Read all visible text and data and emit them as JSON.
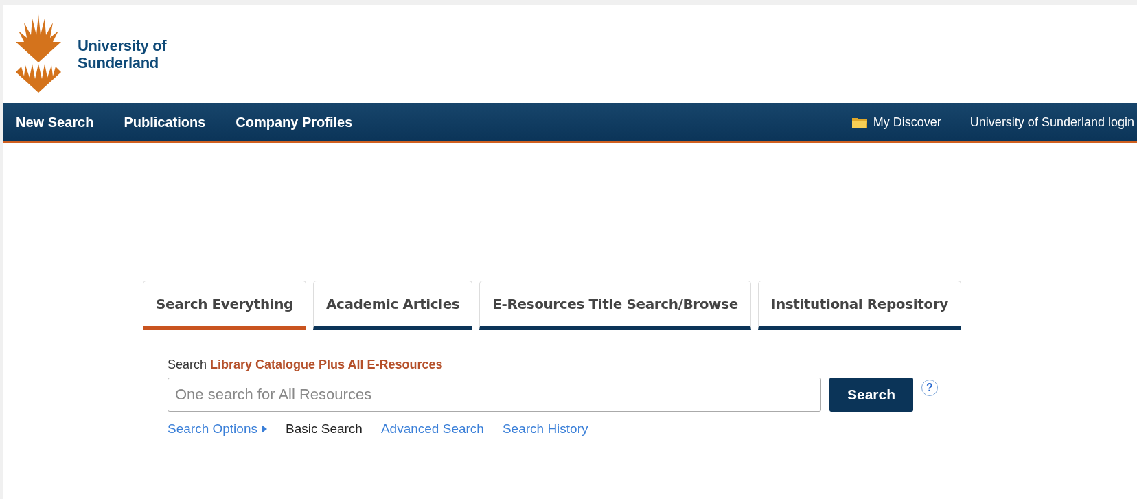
{
  "header": {
    "logo_lines": [
      "University of",
      "Sunderland"
    ]
  },
  "nav": {
    "left": [
      {
        "label": "New Search"
      },
      {
        "label": "Publications"
      },
      {
        "label": "Company Profiles"
      }
    ],
    "right": [
      {
        "label": "My Discover",
        "kind": "folder"
      },
      {
        "label": "University of Sunderland login",
        "kind": "plain"
      }
    ]
  },
  "tabs": [
    {
      "label": "Search Everything",
      "selected": true
    },
    {
      "label": "Academic Articles",
      "selected": false
    },
    {
      "label": "E-Resources Title Search/Browse",
      "selected": false
    },
    {
      "label": "Institutional Repository",
      "selected": false
    }
  ],
  "search": {
    "scope": "Search **Library Catalogue Plus All E-Resources**",
    "placeholder": "One search for All Resources",
    "button": "Search",
    "help": "?"
  },
  "links": [
    {
      "label": "Search Options",
      "kind": "options",
      "selected": false
    },
    {
      "label": "Basic Search",
      "kind": "mode",
      "selected": true
    },
    {
      "label": "Advanced Search",
      "kind": "mode",
      "selected": false
    },
    {
      "label": "Search History",
      "kind": "mode",
      "selected": false
    }
  ]
}
